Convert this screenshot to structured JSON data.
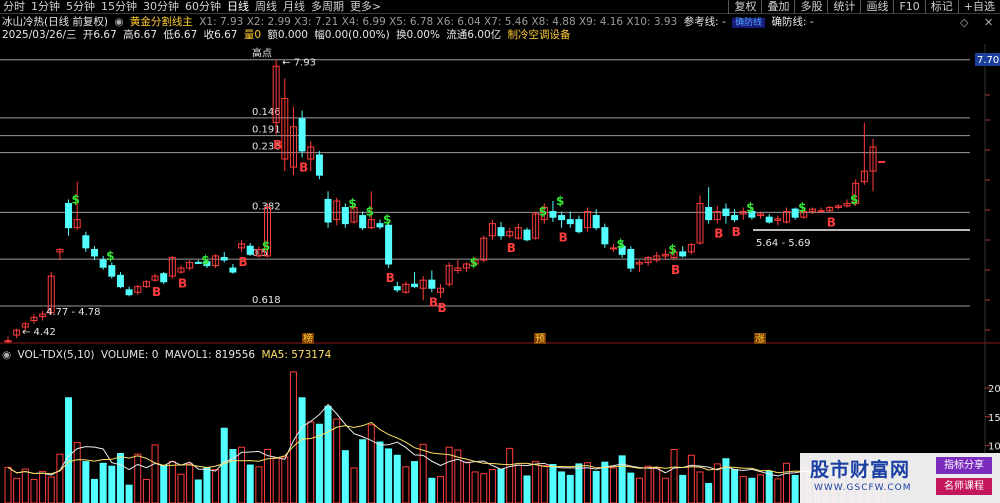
{
  "toolbar": {
    "tabs": [
      "分时",
      "1分钟",
      "5分钟",
      "15分钟",
      "30分钟",
      "60分钟",
      "日线",
      "周线",
      "月线",
      "多周期",
      "更多>"
    ],
    "active_tab": "日线",
    "tools": [
      "复权",
      "叠加",
      "多股",
      "统计",
      "画线",
      "F10",
      "标记",
      "+自选"
    ]
  },
  "header": {
    "stock": "冰山冷热(日线 前复权)",
    "indicator": "黄金分割线主",
    "x_values": "X1: 7.93  X2: 2.99  X3: 7.21  X4: 6.99  X5: 6.78  X6: 6.04  X7: 5.46  X8: 4.88  X9: 4.16  X10: 3.93",
    "ref_line": "参考线: -",
    "label_box": "确防线",
    "confirm_line": "确防线: -"
  },
  "ohlc": {
    "date": "2025/03/26/三",
    "open": "开6.67",
    "high": "高6.67",
    "low": "低6.67",
    "close": "收6.67",
    "volume": "量0",
    "amount": "额0.000",
    "change": "幅0.00(0.00%)",
    "turnover": "换0.00%",
    "float": "流通6.00亿",
    "sector": "制冷空调设备"
  },
  "colors": {
    "up": "#ff3c3c",
    "down": "#54ffff",
    "signal_b": "#ff3c3c",
    "signal_s": "#33e633",
    "fib_line": "#9a9a9a",
    "ma_white": "#e8e8e8",
    "ma_yellow": "#ffe066"
  },
  "fib_labels": [
    "高点",
    "0.146",
    "0.191",
    "0.236",
    "0.382",
    "0.5",
    "0.618"
  ],
  "price_labels": {
    "high": "7.93",
    "low": "4.42",
    "range1": "4.77 - 4.78",
    "range2": "5.64 - 5.69",
    "right_tag": "7.70"
  },
  "event_markers": [
    "榜",
    "预",
    "涨"
  ],
  "volume_panel": {
    "title": "VOL-TDX(5,10)",
    "volume": "VOLUME: 0",
    "mavol1": "MAVOL1: 819556",
    "ma5": "MA5: 573174",
    "axis": [
      "20",
      "15",
      "10"
    ]
  },
  "watermark": {
    "brand": "股市财富网",
    "url": "WWW.GSCFW.COM",
    "badge1": "指标分享",
    "badge2": "名师课程"
  },
  "chart_data": {
    "type": "candlestick",
    "candles": [
      {
        "o": 4.45,
        "h": 4.5,
        "l": 4.42,
        "c": 4.45
      },
      {
        "o": 4.52,
        "h": 4.6,
        "l": 4.48,
        "c": 4.58
      },
      {
        "o": 4.62,
        "h": 4.68,
        "l": 4.57,
        "c": 4.66
      },
      {
        "o": 4.7,
        "h": 4.78,
        "l": 4.66,
        "c": 4.74
      },
      {
        "o": 4.75,
        "h": 4.82,
        "l": 4.7,
        "c": 4.78
      },
      {
        "o": 4.8,
        "h": 5.3,
        "l": 4.77,
        "c": 5.25
      },
      {
        "o": 5.55,
        "h": 5.6,
        "l": 5.45,
        "c": 5.58
      },
      {
        "o": 6.15,
        "h": 6.2,
        "l": 5.75,
        "c": 5.85
      },
      {
        "o": 5.85,
        "h": 6.42,
        "l": 5.82,
        "c": 5.95
      },
      {
        "o": 5.75,
        "h": 5.8,
        "l": 5.55,
        "c": 5.6
      },
      {
        "o": 5.58,
        "h": 5.62,
        "l": 5.45,
        "c": 5.5
      },
      {
        "o": 5.45,
        "h": 5.5,
        "l": 5.33,
        "c": 5.36
      },
      {
        "o": 5.38,
        "h": 5.42,
        "l": 5.22,
        "c": 5.25
      },
      {
        "o": 5.26,
        "h": 5.3,
        "l": 5.1,
        "c": 5.12
      },
      {
        "o": 5.08,
        "h": 5.12,
        "l": 5.0,
        "c": 5.02
      },
      {
        "o": 5.05,
        "h": 5.14,
        "l": 5.02,
        "c": 5.12
      },
      {
        "o": 5.12,
        "h": 5.2,
        "l": 5.1,
        "c": 5.18
      },
      {
        "o": 5.2,
        "h": 5.28,
        "l": 5.18,
        "c": 5.25
      },
      {
        "o": 5.28,
        "h": 5.3,
        "l": 5.15,
        "c": 5.18
      },
      {
        "o": 5.25,
        "h": 5.5,
        "l": 5.22,
        "c": 5.48
      },
      {
        "o": 5.3,
        "h": 5.38,
        "l": 5.28,
        "c": 5.35
      },
      {
        "o": 5.35,
        "h": 5.45,
        "l": 5.32,
        "c": 5.42
      },
      {
        "o": 5.42,
        "h": 5.45,
        "l": 5.4,
        "c": 5.41
      },
      {
        "o": 5.43,
        "h": 5.46,
        "l": 5.35,
        "c": 5.38
      },
      {
        "o": 5.38,
        "h": 5.52,
        "l": 5.35,
        "c": 5.5
      },
      {
        "o": 5.48,
        "h": 5.55,
        "l": 5.42,
        "c": 5.45
      },
      {
        "o": 5.35,
        "h": 5.4,
        "l": 5.28,
        "c": 5.3
      },
      {
        "o": 5.6,
        "h": 5.7,
        "l": 5.55,
        "c": 5.65
      },
      {
        "o": 5.62,
        "h": 5.66,
        "l": 5.5,
        "c": 5.52
      },
      {
        "o": 5.5,
        "h": 5.62,
        "l": 5.48,
        "c": 5.58
      },
      {
        "o": 5.5,
        "h": 6.15,
        "l": 5.48,
        "c": 6.1
      },
      {
        "o": 7.15,
        "h": 7.93,
        "l": 7.0,
        "c": 7.85
      },
      {
        "o": 6.7,
        "h": 7.7,
        "l": 6.55,
        "c": 7.45
      },
      {
        "o": 6.6,
        "h": 7.35,
        "l": 6.5,
        "c": 7.1
      },
      {
        "o": 7.2,
        "h": 7.3,
        "l": 6.72,
        "c": 6.8
      },
      {
        "o": 6.7,
        "h": 6.92,
        "l": 6.55,
        "c": 6.85
      },
      {
        "o": 6.75,
        "h": 6.8,
        "l": 6.45,
        "c": 6.5
      },
      {
        "o": 6.2,
        "h": 6.3,
        "l": 5.85,
        "c": 5.92
      },
      {
        "o": 5.95,
        "h": 6.22,
        "l": 5.88,
        "c": 6.18
      },
      {
        "o": 6.1,
        "h": 6.15,
        "l": 5.85,
        "c": 5.9
      },
      {
        "o": 5.92,
        "h": 6.15,
        "l": 5.9,
        "c": 6.1
      },
      {
        "o": 6.0,
        "h": 6.05,
        "l": 5.82,
        "c": 5.85
      },
      {
        "o": 5.85,
        "h": 6.3,
        "l": 5.83,
        "c": 5.95
      },
      {
        "o": 5.9,
        "h": 5.95,
        "l": 5.83,
        "c": 5.86
      },
      {
        "o": 5.88,
        "h": 5.92,
        "l": 5.35,
        "c": 5.4
      },
      {
        "o": 5.12,
        "h": 5.18,
        "l": 5.05,
        "c": 5.08
      },
      {
        "o": 5.05,
        "h": 5.18,
        "l": 5.03,
        "c": 5.15
      },
      {
        "o": 5.15,
        "h": 5.3,
        "l": 5.1,
        "c": 5.12
      },
      {
        "o": 5.1,
        "h": 5.25,
        "l": 4.95,
        "c": 5.2
      },
      {
        "o": 5.2,
        "h": 5.32,
        "l": 5.05,
        "c": 5.1
      },
      {
        "o": 5.05,
        "h": 5.15,
        "l": 4.98,
        "c": 5.1
      },
      {
        "o": 5.15,
        "h": 5.42,
        "l": 5.12,
        "c": 5.38
      },
      {
        "o": 5.32,
        "h": 5.45,
        "l": 5.28,
        "c": 5.35
      },
      {
        "o": 5.35,
        "h": 5.42,
        "l": 5.3,
        "c": 5.4
      },
      {
        "o": 5.4,
        "h": 5.48,
        "l": 5.38,
        "c": 5.45
      },
      {
        "o": 5.45,
        "h": 5.75,
        "l": 5.42,
        "c": 5.72
      },
      {
        "o": 5.75,
        "h": 5.95,
        "l": 5.7,
        "c": 5.9
      },
      {
        "o": 5.85,
        "h": 5.92,
        "l": 5.7,
        "c": 5.75
      },
      {
        "o": 5.75,
        "h": 5.85,
        "l": 5.72,
        "c": 5.8
      },
      {
        "o": 5.72,
        "h": 5.9,
        "l": 5.7,
        "c": 5.85
      },
      {
        "o": 5.82,
        "h": 5.85,
        "l": 5.68,
        "c": 5.7
      },
      {
        "o": 5.72,
        "h": 6.05,
        "l": 5.7,
        "c": 6.02
      },
      {
        "o": 5.95,
        "h": 6.15,
        "l": 5.9,
        "c": 6.1
      },
      {
        "o": 6.05,
        "h": 6.18,
        "l": 5.92,
        "c": 5.98
      },
      {
        "o": 6.0,
        "h": 6.05,
        "l": 5.85,
        "c": 5.95
      },
      {
        "o": 5.95,
        "h": 6.05,
        "l": 5.85,
        "c": 5.9
      },
      {
        "o": 5.95,
        "h": 6.0,
        "l": 5.78,
        "c": 5.8
      },
      {
        "o": 5.85,
        "h": 6.1,
        "l": 5.8,
        "c": 6.05
      },
      {
        "o": 6.0,
        "h": 6.08,
        "l": 5.82,
        "c": 5.85
      },
      {
        "o": 5.85,
        "h": 5.9,
        "l": 5.6,
        "c": 5.65
      },
      {
        "o": 5.6,
        "h": 5.65,
        "l": 5.55,
        "c": 5.6
      },
      {
        "o": 5.62,
        "h": 5.68,
        "l": 5.48,
        "c": 5.52
      },
      {
        "o": 5.58,
        "h": 5.62,
        "l": 5.3,
        "c": 5.35
      },
      {
        "o": 5.4,
        "h": 5.45,
        "l": 5.3,
        "c": 5.42
      },
      {
        "o": 5.42,
        "h": 5.5,
        "l": 5.38,
        "c": 5.48
      },
      {
        "o": 5.45,
        "h": 5.55,
        "l": 5.42,
        "c": 5.5
      },
      {
        "o": 5.5,
        "h": 5.58,
        "l": 5.45,
        "c": 5.52
      },
      {
        "o": 5.48,
        "h": 5.6,
        "l": 5.45,
        "c": 5.55
      },
      {
        "o": 5.55,
        "h": 5.62,
        "l": 5.48,
        "c": 5.5
      },
      {
        "o": 5.55,
        "h": 5.66,
        "l": 5.52,
        "c": 5.64
      },
      {
        "o": 5.66,
        "h": 6.25,
        "l": 5.64,
        "c": 6.15
      },
      {
        "o": 6.1,
        "h": 6.35,
        "l": 5.9,
        "c": 5.95
      },
      {
        "o": 5.95,
        "h": 6.12,
        "l": 5.9,
        "c": 6.05
      },
      {
        "o": 6.08,
        "h": 6.15,
        "l": 5.9,
        "c": 6.0
      },
      {
        "o": 6.0,
        "h": 6.08,
        "l": 5.92,
        "c": 5.95
      },
      {
        "o": 6.02,
        "h": 6.1,
        "l": 5.95,
        "c": 6.05
      },
      {
        "o": 6.05,
        "h": 6.1,
        "l": 5.95,
        "c": 5.98
      },
      {
        "o": 6.0,
        "h": 6.05,
        "l": 5.96,
        "c": 6.02
      },
      {
        "o": 5.98,
        "h": 6.02,
        "l": 5.9,
        "c": 5.92
      },
      {
        "o": 5.94,
        "h": 6.0,
        "l": 5.88,
        "c": 5.96
      },
      {
        "o": 5.92,
        "h": 6.1,
        "l": 5.9,
        "c": 6.05
      },
      {
        "o": 6.08,
        "h": 6.1,
        "l": 5.95,
        "c": 5.98
      },
      {
        "o": 5.98,
        "h": 6.08,
        "l": 5.96,
        "c": 6.05
      },
      {
        "o": 6.05,
        "h": 6.1,
        "l": 6.02,
        "c": 6.08
      },
      {
        "o": 6.05,
        "h": 6.1,
        "l": 6.04,
        "c": 6.06
      },
      {
        "o": 6.06,
        "h": 6.12,
        "l": 6.04,
        "c": 6.1
      },
      {
        "o": 6.1,
        "h": 6.14,
        "l": 6.08,
        "c": 6.12
      },
      {
        "o": 6.12,
        "h": 6.2,
        "l": 6.1,
        "c": 6.15
      },
      {
        "o": 6.15,
        "h": 6.45,
        "l": 6.12,
        "c": 6.4
      },
      {
        "o": 6.42,
        "h": 7.15,
        "l": 6.38,
        "c": 6.55
      },
      {
        "o": 6.55,
        "h": 6.95,
        "l": 6.3,
        "c": 6.85
      },
      {
        "o": 6.67,
        "h": 6.67,
        "l": 6.67,
        "c": 6.67
      }
    ],
    "signals": [
      {
        "t": "S",
        "i": 7
      },
      {
        "t": "S",
        "i": 11
      },
      {
        "t": "B",
        "i": 17
      },
      {
        "t": "B",
        "i": 20
      },
      {
        "t": "S",
        "i": 22
      },
      {
        "t": "B",
        "i": 27
      },
      {
        "t": "S",
        "i": 29
      },
      {
        "t": "B",
        "i": 31
      },
      {
        "t": "B",
        "i": 34
      },
      {
        "t": "S",
        "i": 39
      },
      {
        "t": "S",
        "i": 41
      },
      {
        "t": "B",
        "i": 44
      },
      {
        "t": "S",
        "i": 43
      },
      {
        "t": "B",
        "i": 49
      },
      {
        "t": "B",
        "i": 50
      },
      {
        "t": "S",
        "i": 53
      },
      {
        "t": "B",
        "i": 58
      },
      {
        "t": "S",
        "i": 61
      },
      {
        "t": "S",
        "i": 63
      },
      {
        "t": "B",
        "i": 64
      },
      {
        "t": "S",
        "i": 70
      },
      {
        "t": "S",
        "i": 76
      },
      {
        "t": "B",
        "i": 77
      },
      {
        "t": "B",
        "i": 82
      },
      {
        "t": "B",
        "i": 84
      },
      {
        "t": "S",
        "i": 85
      },
      {
        "t": "S",
        "i": 91
      },
      {
        "t": "B",
        "i": 95
      },
      {
        "t": "S",
        "i": 97
      }
    ],
    "fib_levels": [
      7.93,
      7.21,
      6.99,
      6.78,
      6.04,
      5.46,
      4.88
    ],
    "volumes": [
      6.2,
      4.3,
      5.9,
      4.1,
      5.5,
      4.5,
      8.5,
      18.3,
      10.5,
      7.2,
      4.1,
      6.9,
      6.4,
      8.6,
      3.1,
      8.5,
      4.1,
      10.1,
      6.5,
      7.2,
      5.0,
      6.8,
      4.0,
      6.2,
      5.8,
      13.0,
      9.3,
      9.7,
      6.6,
      6.3,
      9.3,
      7.8,
      8.0,
      22.8,
      18.3,
      14.1,
      13.7,
      16.8,
      14.6,
      9.1,
      6.1,
      11.0,
      13.6,
      10.6,
      9.4,
      8.3,
      6.3,
      7.2,
      10.2,
      4.3,
      4.6,
      9.7,
      9.2,
      7.1,
      5.4,
      5.1,
      5.8,
      5.9,
      9.5,
      6.6,
      4.7,
      7.2,
      6.5,
      6.7,
      5.4,
      4.8,
      6.8,
      7.0,
      5.5,
      7.1,
      6.1,
      8.2,
      5.2,
      4.3,
      6.4,
      6.1,
      4.3,
      9.3,
      4.8,
      8.3,
      5.4,
      3.4,
      6.8,
      7.7,
      5.8,
      4.6,
      4.3,
      4.9,
      5.5,
      4.2,
      6.9,
      4.8,
      6.1,
      6.0,
      4.1,
      4.4,
      5.2,
      4.9,
      3.5,
      7.4,
      4.2,
      4.3
    ]
  }
}
